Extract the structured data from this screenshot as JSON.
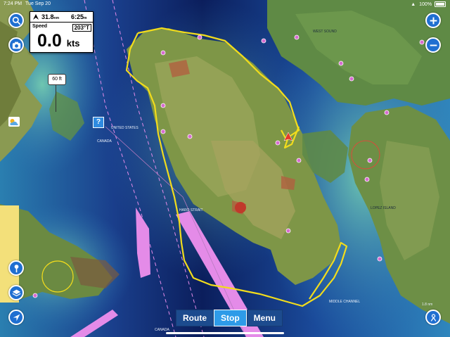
{
  "status_bar": {
    "time": "7:24 PM",
    "date": "Tue Sep 20",
    "battery": "100%"
  },
  "instrument": {
    "sog_small": "31.8",
    "sog_small_unit": "nm",
    "time_value": "6:25",
    "time_unit": "m",
    "speed_label": "Speed",
    "heading": "203°T",
    "speed_value": "0.0",
    "speed_unit": "kts"
  },
  "depth_badge": "60 ft",
  "info_button": "?",
  "bottom_bar": {
    "route_label": "Route",
    "stop_label": "Stop",
    "menu_label": "Menu"
  },
  "map_labels": {
    "united_states": "UNITED STATES",
    "canada": "CANADA",
    "haro_strait": "HARO STRAIT",
    "lopez_island": "LOPEZ ISLAND",
    "middle_channel": "MIDDLE CHANNEL",
    "canada_bottom": "CANADA",
    "west_sound": "WEST SOUND",
    "scale": "1.8 nm"
  },
  "icons": [
    "search-icon",
    "camera-icon",
    "weather-icon",
    "pin-icon",
    "layers-icon",
    "compass-icon",
    "plus-icon",
    "minus-icon",
    "person-icon",
    "gps-icon",
    "battery-icon",
    "wifi-icon"
  ],
  "colors": {
    "route": "#f2dc1c",
    "exclusion_zone": "#e48be8",
    "button_blue": "#1f6fd1",
    "active_blue": "#2e9be8",
    "deep_water": "#0b2f6b"
  }
}
